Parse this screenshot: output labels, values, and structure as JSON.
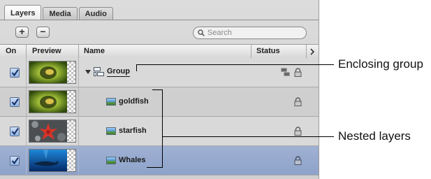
{
  "tabs": [
    "Layers",
    "Media",
    "Audio"
  ],
  "toolbar": {
    "add": "+",
    "remove": "−",
    "search_placeholder": "Search"
  },
  "columns": {
    "on": "On",
    "preview": "Preview",
    "name": "Name",
    "status": "Status"
  },
  "rows": [
    {
      "name": "Group",
      "kind": "group",
      "checked": true
    },
    {
      "name": "goldfish",
      "kind": "layer",
      "checked": true
    },
    {
      "name": "starfish",
      "kind": "layer",
      "checked": true
    },
    {
      "name": "Whales",
      "kind": "layer",
      "checked": true,
      "selected": true
    }
  ],
  "annotations": {
    "enclosing": "Enclosing group",
    "nested": "Nested layers"
  },
  "colors": {
    "selection": "#95a9cf",
    "panel": "#d6d6d6",
    "checkbox": "#8fb2e2"
  },
  "icons": [
    "plus-icon",
    "minus-icon",
    "search-icon",
    "disclosure-triangle-icon",
    "group-icon",
    "layer-icon",
    "lock-icon",
    "group-status-icon",
    "checkmark-icon",
    "chevron-right-icon"
  ]
}
